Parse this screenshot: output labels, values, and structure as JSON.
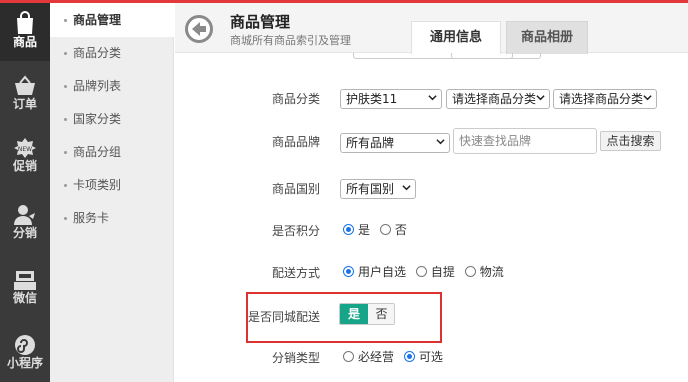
{
  "left_nav": {
    "items": [
      {
        "label": "商品",
        "icon": "shopping-bag-icon",
        "active": true
      },
      {
        "label": "订单",
        "icon": "basket-icon",
        "active": false
      },
      {
        "label": "促销",
        "icon": "new-badge-icon",
        "active": false
      },
      {
        "label": "分销",
        "icon": "user-share-icon",
        "active": false
      },
      {
        "label": "微信",
        "icon": "wechat-register-icon",
        "active": false
      },
      {
        "label": "小程序",
        "icon": "mini-program-icon",
        "active": false
      }
    ]
  },
  "sub_nav": {
    "items": [
      {
        "label": "商品管理",
        "active": true
      },
      {
        "label": "商品分类",
        "active": false
      },
      {
        "label": "品牌列表",
        "active": false
      },
      {
        "label": "国家分类",
        "active": false
      },
      {
        "label": "商品分组",
        "active": false
      },
      {
        "label": "卡项类别",
        "active": false
      },
      {
        "label": "服务卡",
        "active": false
      }
    ]
  },
  "header": {
    "title": "商品管理",
    "subtitle": "商城所有商品索引及管理",
    "tabs": [
      {
        "label": "通用信息",
        "active": true
      },
      {
        "label": "商品相册",
        "active": false
      }
    ]
  },
  "form": {
    "category": {
      "label": "商品分类",
      "select1": "护肤类11",
      "select2": "请选择商品分类",
      "select3": "请选择商品分类"
    },
    "brand": {
      "label": "商品品牌",
      "select": "所有品牌",
      "search_placeholder": "快速查找品牌",
      "search_button": "点击搜索"
    },
    "country": {
      "label": "商品国别",
      "select": "所有国别"
    },
    "points": {
      "label": "是否积分",
      "options": [
        {
          "label": "是",
          "checked": true
        },
        {
          "label": "否",
          "checked": false
        }
      ]
    },
    "delivery": {
      "label": "配送方式",
      "options": [
        {
          "label": "用户自选",
          "checked": true
        },
        {
          "label": "自提",
          "checked": false
        },
        {
          "label": "物流",
          "checked": false
        }
      ]
    },
    "same_city": {
      "label": "是否同城配送",
      "yes": "是",
      "no": "否",
      "value": "是"
    },
    "distribution": {
      "label": "分销类型",
      "options": [
        {
          "label": "必经营",
          "checked": false
        },
        {
          "label": "可选",
          "checked": true
        }
      ]
    }
  },
  "colors": {
    "accent_red": "#e4393c",
    "toggle_on": "#17a589",
    "radio_blue": "#1a73e8",
    "highlight_border": "#e03131"
  }
}
